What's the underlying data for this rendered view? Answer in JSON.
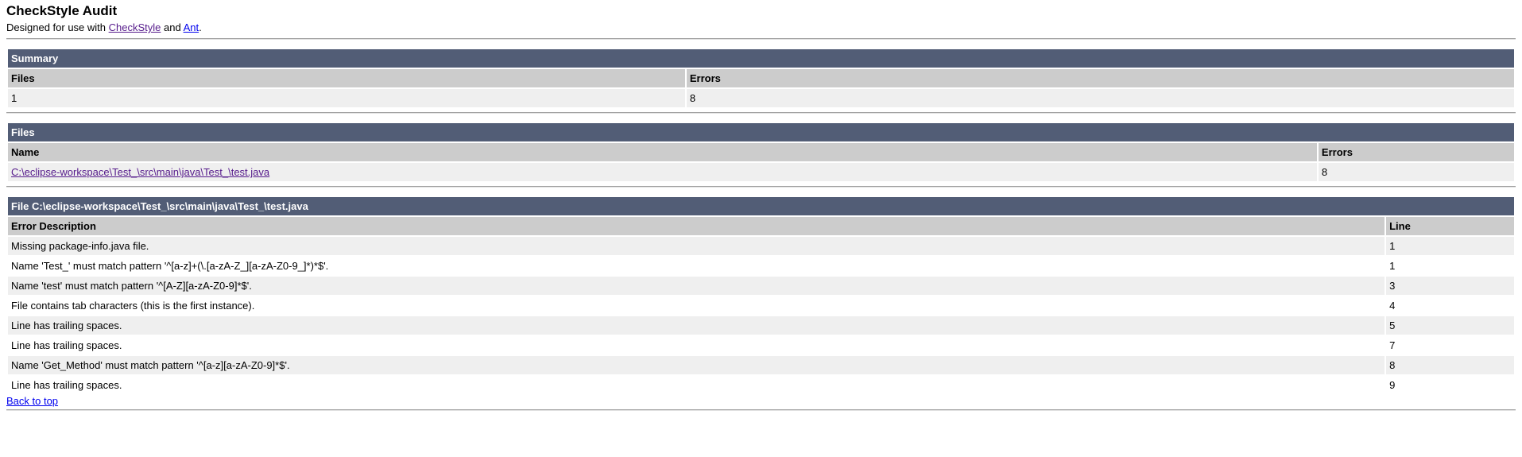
{
  "header": {
    "title": "CheckStyle Audit",
    "designed_prefix": "Designed for use with ",
    "checkstyle_link": "CheckStyle",
    "and_text": " and ",
    "ant_link": "Ant",
    "period": "."
  },
  "summary": {
    "title": "Summary",
    "col_files": "Files",
    "col_errors": "Errors",
    "files_value": "1",
    "errors_value": "8"
  },
  "files": {
    "title": "Files",
    "col_name": "Name",
    "col_errors": "Errors",
    "rows": [
      {
        "name": "C:\\eclipse-workspace\\Test_\\src\\main\\java\\Test_\\test.java",
        "errors": "8"
      }
    ]
  },
  "file_detail": {
    "title": "File C:\\eclipse-workspace\\Test_\\src\\main\\java\\Test_\\test.java",
    "col_description": "Error Description",
    "col_line": "Line",
    "rows": [
      {
        "description": "Missing package-info.java file.",
        "line": "1"
      },
      {
        "description": "Name 'Test_' must match pattern '^[a-z]+(\\.[a-zA-Z_][a-zA-Z0-9_]*)*$'.",
        "line": "1"
      },
      {
        "description": "Name 'test' must match pattern '^[A-Z][a-zA-Z0-9]*$'.",
        "line": "3"
      },
      {
        "description": "File contains tab characters (this is the first instance).",
        "line": "4"
      },
      {
        "description": "Line has trailing spaces.",
        "line": "5"
      },
      {
        "description": "Line has trailing spaces.",
        "line": "7"
      },
      {
        "description": "Name 'Get_Method' must match pattern '^[a-z][a-zA-Z0-9]*$'.",
        "line": "8"
      },
      {
        "description": "Line has trailing spaces.",
        "line": "9"
      }
    ],
    "back_to_top": "Back to top"
  }
}
